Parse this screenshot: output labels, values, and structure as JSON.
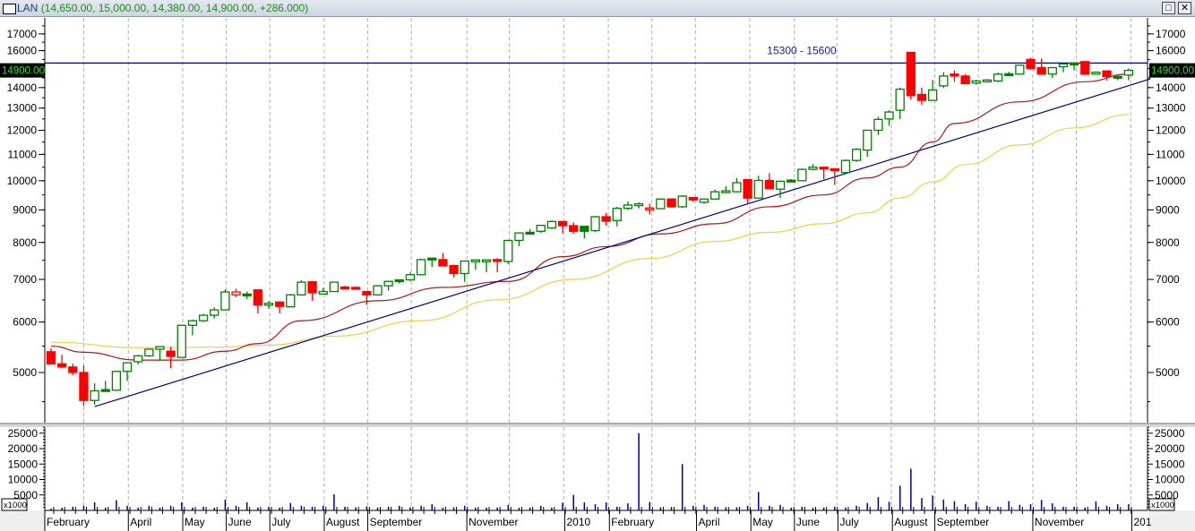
{
  "window": {
    "symbol": "LAN",
    "ohlc_text": "(14,650.00, 15,000.00, 14,380.00, 14,900.00, +286.000)",
    "restore_icon": "restore-icon",
    "close_icon": "close-icon"
  },
  "chart_data": {
    "type": "candlestick",
    "title": "LAN",
    "period": "weekly",
    "scale": "log",
    "ylim": [
      4300,
      17600
    ],
    "price_ticks": [
      "17000",
      "16000",
      "15000",
      "14000",
      "13000",
      "12000",
      "11000",
      "10000",
      "9000",
      "8000",
      "7000",
      "6000",
      "5000"
    ],
    "last_price_label": "14900.00",
    "last_price": 14900,
    "resistance": {
      "value": 15300,
      "label": "15300 - 15600"
    },
    "colors": {
      "up": "#008000",
      "down": "#ff0000",
      "ma_fast": "#b01818",
      "ma_slow": "#f0d040",
      "trend": "#00008b",
      "volume": "#00008b"
    },
    "candles": [
      [
        5390,
        5460,
        5150,
        5160,
        "d"
      ],
      [
        5160,
        5330,
        5080,
        5100,
        "d"
      ],
      [
        5100,
        5160,
        4950,
        5000,
        "d"
      ],
      [
        5000,
        5130,
        4430,
        4520,
        "d"
      ],
      [
        4520,
        4810,
        4450,
        4680,
        "u"
      ],
      [
        4690,
        4850,
        4680,
        4700,
        "uf"
      ],
      [
        4690,
        5020,
        4680,
        5020,
        "u"
      ],
      [
        5020,
        5180,
        4850,
        5180,
        "u"
      ],
      [
        5200,
        5330,
        5150,
        5310,
        "u"
      ],
      [
        5310,
        5450,
        5290,
        5440,
        "u"
      ],
      [
        5440,
        5500,
        5210,
        5490,
        "u"
      ],
      [
        5400,
        5490,
        5080,
        5300,
        "d"
      ],
      [
        5280,
        5940,
        5270,
        5930,
        "u"
      ],
      [
        5930,
        6050,
        5720,
        6030,
        "u"
      ],
      [
        6030,
        6180,
        6000,
        6150,
        "u"
      ],
      [
        6150,
        6330,
        6080,
        6270,
        "u"
      ],
      [
        6270,
        6750,
        6260,
        6690,
        "u"
      ],
      [
        6690,
        6770,
        6560,
        6620,
        "dh"
      ],
      [
        6600,
        6700,
        6520,
        6640,
        "uf"
      ],
      [
        6740,
        6740,
        6190,
        6380,
        "d"
      ],
      [
        6390,
        6470,
        6300,
        6420,
        "u"
      ],
      [
        6450,
        6470,
        6190,
        6350,
        "d"
      ],
      [
        6340,
        6640,
        6330,
        6620,
        "u"
      ],
      [
        6620,
        6980,
        6600,
        6930,
        "u"
      ],
      [
        6940,
        6960,
        6480,
        6670,
        "d"
      ],
      [
        6640,
        6790,
        6630,
        6700,
        "u"
      ],
      [
        6700,
        6930,
        6700,
        6930,
        "u"
      ],
      [
        6810,
        6840,
        6750,
        6800,
        "d"
      ],
      [
        6800,
        6820,
        6770,
        6780,
        "d"
      ],
      [
        6700,
        6710,
        6380,
        6620,
        "d"
      ],
      [
        6620,
        6860,
        6600,
        6840,
        "u"
      ],
      [
        6840,
        6960,
        6720,
        6950,
        "u"
      ],
      [
        6960,
        7000,
        6900,
        6990,
        "uf"
      ],
      [
        6990,
        7180,
        6960,
        7120,
        "u"
      ],
      [
        7120,
        7540,
        7110,
        7520,
        "u"
      ],
      [
        7540,
        7560,
        7320,
        7560,
        "uf"
      ],
      [
        7520,
        7700,
        7340,
        7350,
        "d"
      ],
      [
        7360,
        7380,
        7050,
        7150,
        "d"
      ],
      [
        7150,
        7500,
        6940,
        7480,
        "u"
      ],
      [
        7500,
        7510,
        7250,
        7510,
        "u"
      ],
      [
        7500,
        7520,
        7180,
        7510,
        "u"
      ],
      [
        7520,
        7560,
        7180,
        7500,
        "d"
      ],
      [
        7470,
        8060,
        7400,
        8060,
        "u"
      ],
      [
        8060,
        8300,
        7890,
        8280,
        "u"
      ],
      [
        8280,
        8400,
        8230,
        8300,
        "uf"
      ],
      [
        8330,
        8510,
        8280,
        8510,
        "u"
      ],
      [
        8430,
        8660,
        8400,
        8630,
        "u"
      ],
      [
        8630,
        8640,
        8270,
        8500,
        "d"
      ],
      [
        8500,
        8600,
        8260,
        8330,
        "d"
      ],
      [
        8480,
        8500,
        8120,
        8330,
        "uf"
      ],
      [
        8350,
        8800,
        8300,
        8780,
        "u"
      ],
      [
        8780,
        8900,
        8500,
        8640,
        "d"
      ],
      [
        8660,
        9100,
        8480,
        9050,
        "u"
      ],
      [
        9050,
        9280,
        9000,
        9160,
        "u"
      ],
      [
        9160,
        9250,
        9050,
        9200,
        "u"
      ],
      [
        9060,
        9200,
        8850,
        9000,
        "dh"
      ],
      [
        9040,
        9360,
        9040,
        9360,
        "u"
      ],
      [
        9360,
        9380,
        9100,
        9100,
        "d"
      ],
      [
        9100,
        9490,
        9060,
        9460,
        "u"
      ],
      [
        9410,
        9420,
        9260,
        9330,
        "d"
      ],
      [
        9250,
        9360,
        9200,
        9360,
        "u"
      ],
      [
        9360,
        9690,
        9360,
        9610,
        "u"
      ],
      [
        9620,
        9800,
        9550,
        9640,
        "u"
      ],
      [
        9610,
        10100,
        9600,
        9930,
        "u"
      ],
      [
        10040,
        10040,
        9200,
        9390,
        "d"
      ],
      [
        9390,
        10180,
        9380,
        10010,
        "u"
      ],
      [
        10010,
        10280,
        9700,
        9720,
        "d"
      ],
      [
        9700,
        9990,
        9400,
        9980,
        "u"
      ],
      [
        9980,
        10060,
        9980,
        10020,
        "uf"
      ],
      [
        10000,
        10450,
        9980,
        10420,
        "u"
      ],
      [
        10420,
        10620,
        10380,
        10500,
        "u"
      ],
      [
        10500,
        10520,
        10050,
        10450,
        "d"
      ],
      [
        10440,
        10460,
        9850,
        10390,
        "d"
      ],
      [
        10300,
        10800,
        10300,
        10760,
        "u"
      ],
      [
        10760,
        11250,
        10700,
        11200,
        "u"
      ],
      [
        11170,
        12020,
        10900,
        12000,
        "u"
      ],
      [
        12000,
        12600,
        11800,
        12480,
        "u"
      ],
      [
        12500,
        12900,
        12200,
        12820,
        "u"
      ],
      [
        12900,
        14000,
        12500,
        13920,
        "u"
      ],
      [
        15900,
        15900,
        13400,
        13600,
        "d"
      ],
      [
        13660,
        14000,
        13150,
        13370,
        "d"
      ],
      [
        13370,
        14400,
        13370,
        13880,
        "u"
      ],
      [
        14090,
        14800,
        13980,
        14600,
        "u"
      ],
      [
        14700,
        14900,
        14300,
        14600,
        "d"
      ],
      [
        14600,
        14700,
        14180,
        14200,
        "d"
      ],
      [
        14230,
        14400,
        14150,
        14340,
        "u"
      ],
      [
        14370,
        14430,
        14250,
        14390,
        "u"
      ],
      [
        14340,
        14780,
        14280,
        14700,
        "u"
      ],
      [
        14720,
        14820,
        14600,
        14680,
        "uf"
      ],
      [
        14700,
        15200,
        14680,
        15180,
        "u"
      ],
      [
        15500,
        15600,
        14950,
        15000,
        "d"
      ],
      [
        15050,
        15550,
        14700,
        14700,
        "d"
      ],
      [
        14700,
        15050,
        14500,
        15050,
        "u"
      ],
      [
        15100,
        15300,
        14800,
        15250,
        "u"
      ],
      [
        15300,
        15300,
        14900,
        15270,
        "uf"
      ],
      [
        15380,
        15380,
        14650,
        14700,
        "d"
      ],
      [
        14700,
        14850,
        14680,
        14800,
        "u"
      ],
      [
        14870,
        14900,
        14350,
        14570,
        "d"
      ],
      [
        14580,
        14620,
        14380,
        14560,
        "uf"
      ],
      [
        14650,
        15000,
        14380,
        14900,
        "u"
      ]
    ],
    "ma_fast": [
      [
        0,
        5500
      ],
      [
        3,
        5380
      ],
      [
        8,
        5230
      ],
      [
        12,
        5230
      ],
      [
        16,
        5400
      ],
      [
        19,
        5550
      ],
      [
        23,
        6030
      ],
      [
        30,
        6480
      ],
      [
        36,
        6800
      ],
      [
        42,
        6950
      ],
      [
        47,
        7600
      ],
      [
        51,
        7880
      ],
      [
        56,
        8250
      ],
      [
        61,
        8560
      ],
      [
        66,
        9100
      ],
      [
        71,
        9500
      ],
      [
        75,
        10100
      ],
      [
        78,
        10500
      ],
      [
        81,
        11500
      ],
      [
        83,
        12300
      ],
      [
        89,
        13300
      ],
      [
        95,
        14300
      ],
      [
        99,
        14700
      ]
    ],
    "ma_slow": [
      [
        0,
        5580
      ],
      [
        8,
        5470
      ],
      [
        15,
        5480
      ],
      [
        20,
        5520
      ],
      [
        26,
        5700
      ],
      [
        34,
        6030
      ],
      [
        41,
        6500
      ],
      [
        48,
        7000
      ],
      [
        55,
        7550
      ],
      [
        61,
        8030
      ],
      [
        66,
        8300
      ],
      [
        71,
        8560
      ],
      [
        75,
        8900
      ],
      [
        78,
        9400
      ],
      [
        81,
        9950
      ],
      [
        84,
        10600
      ],
      [
        89,
        11380
      ],
      [
        94,
        12100
      ],
      [
        99,
        12700
      ]
    ],
    "trendline": [
      [
        4,
        4420
      ],
      [
        101,
        14450
      ]
    ],
    "volume": {
      "unit_label": "x1000",
      "ticks": [
        "25000",
        "20000",
        "15000",
        "10000",
        "5000"
      ],
      "ylim": [
        0,
        28000
      ],
      "values": [
        600,
        900,
        1200,
        1500,
        2600,
        900,
        3300,
        1500,
        900,
        1500,
        900,
        1500,
        2600,
        900,
        1200,
        900,
        3500,
        1500,
        2600,
        900,
        1200,
        900,
        2400,
        1500,
        1200,
        1500,
        5200,
        1200,
        1000,
        1300,
        900,
        1200,
        1500,
        1000,
        1500,
        2000,
        900,
        1000,
        1500,
        900,
        900,
        900,
        1800,
        900,
        900,
        1500,
        900,
        2500,
        5000,
        2600,
        2000,
        2600,
        1200,
        2300,
        25000,
        2700,
        1000,
        1100,
        15000,
        1500,
        1800,
        1200,
        1000,
        1000,
        1500,
        6000,
        1500,
        1800,
        900,
        1200,
        900,
        900,
        1200,
        900,
        1500,
        2400,
        4300,
        2800,
        8000,
        13500,
        4000,
        4800,
        3500,
        3000,
        2000,
        2800,
        1500,
        1200,
        3000,
        1800,
        2000,
        3400,
        2300,
        1200,
        1200,
        900,
        2900,
        1500,
        2000,
        2000
      ]
    },
    "x_axis": {
      "labels": [
        {
          "text": "February",
          "at": -0.6
        },
        {
          "text": "April",
          "at": 7.1
        },
        {
          "text": "May",
          "at": 12.1
        },
        {
          "text": "June",
          "at": 16.1
        },
        {
          "text": "July",
          "at": 20.1
        },
        {
          "text": "August",
          "at": 25.1
        },
        {
          "text": "September",
          "at": 29.1
        },
        {
          "text": "November",
          "at": 38.2
        },
        {
          "text": "2010",
          "at": 47.2
        },
        {
          "text": "February",
          "at": 51.3
        },
        {
          "text": "April",
          "at": 59.3
        },
        {
          "text": "May",
          "at": 64.3
        },
        {
          "text": "June",
          "at": 68.3
        },
        {
          "text": "July",
          "at": 72.3
        },
        {
          "text": "August",
          "at": 77.3
        },
        {
          "text": "September",
          "at": 81.2
        },
        {
          "text": "November",
          "at": 90.2
        },
        {
          "text": "201",
          "at": 99.3
        }
      ],
      "gridlines": [
        3.0,
        7.1,
        12.1,
        16.1,
        20.1,
        25.1,
        29.1,
        33.1,
        38.2,
        42.1,
        47.1,
        51.2,
        55.2,
        59.2,
        64.2,
        68.3,
        72.2,
        77.2,
        81.2,
        85.2,
        90.2,
        94.2,
        99.2
      ]
    }
  }
}
